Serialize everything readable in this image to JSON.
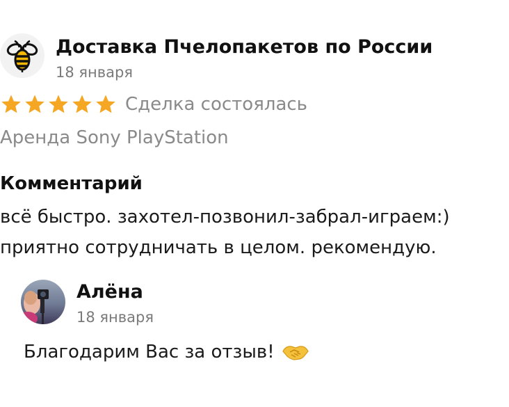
{
  "review": {
    "reviewer": {
      "name": "Доставка Пчелопакетов по России",
      "date": "18 января",
      "logo_icon": "bee-icon"
    },
    "rating": {
      "stars": 5,
      "max_stars": 5,
      "star_color": "#f5a623",
      "status": "Сделка состоялась"
    },
    "item_title": "Аренда Sony PlayStation",
    "comment": {
      "heading": "Комментарий",
      "lines": [
        "всё быстро. захотел-позвонил-забрал-играем:)",
        "приятно сотрудничать в целом. рекомендую."
      ]
    },
    "reply": {
      "author": "Алёна",
      "date": "18 января",
      "text": "Благодарим Вас за отзыв!",
      "emoji_icon": "handshake-icon"
    }
  }
}
